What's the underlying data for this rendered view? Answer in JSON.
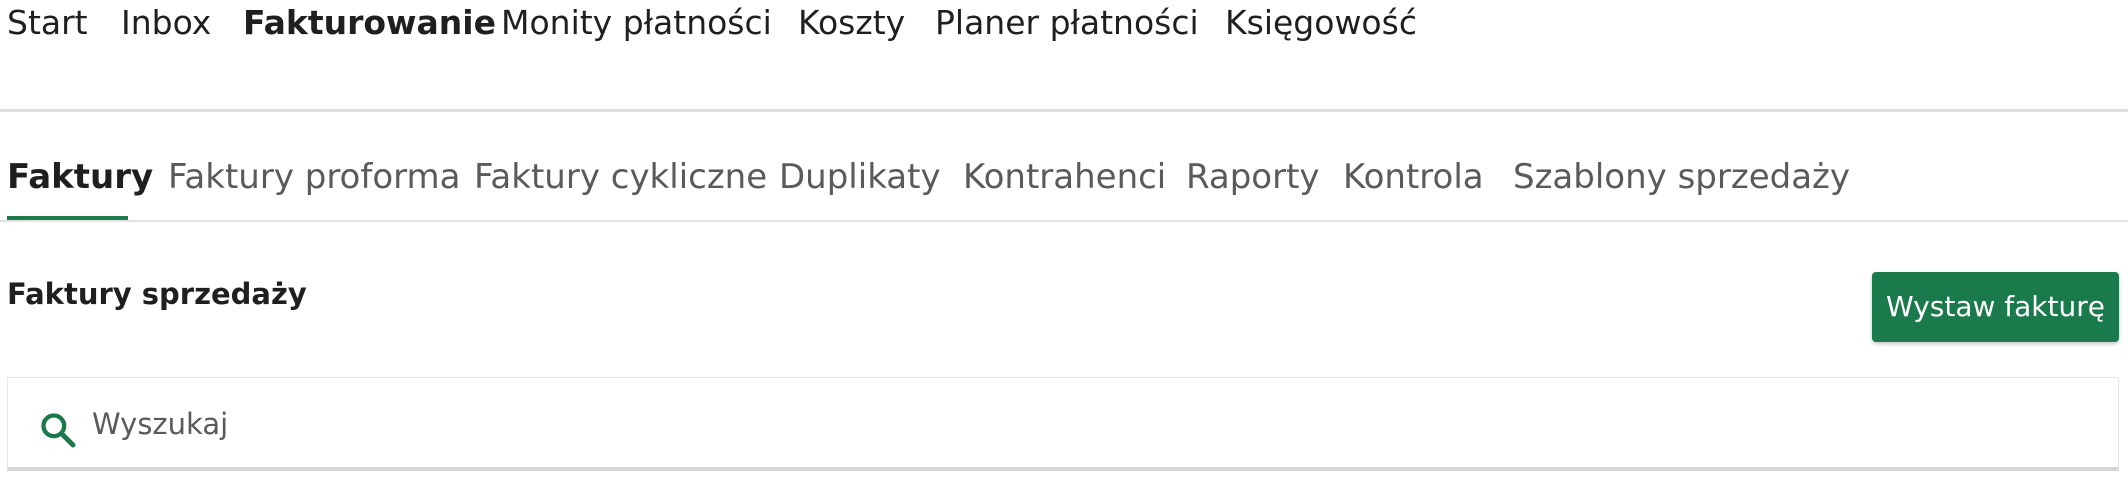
{
  "top_nav": {
    "items": [
      {
        "label": "Start"
      },
      {
        "label": "Inbox"
      },
      {
        "label": "Fakturowanie"
      },
      {
        "label": "Monity płatności"
      },
      {
        "label": "Koszty"
      },
      {
        "label": "Planer płatności"
      },
      {
        "label": "Księgowość"
      }
    ],
    "active": "Fakturowanie"
  },
  "sub_tabs": {
    "items": [
      {
        "label": "Faktury"
      },
      {
        "label": "Faktury proforma"
      },
      {
        "label": "Faktury cykliczne"
      },
      {
        "label": "Duplikaty"
      },
      {
        "label": "Kontrahenci"
      },
      {
        "label": "Raporty"
      },
      {
        "label": "Kontrola"
      },
      {
        "label": "Szablony sprzedaży"
      }
    ],
    "active": "Faktury"
  },
  "section": {
    "title": "Faktury sprzedaży",
    "primary_button_label": "Wystaw fakturę"
  },
  "search": {
    "placeholder": "Wyszukaj",
    "icon": "search-icon"
  },
  "colors": {
    "accent": "#1a7a4c",
    "text": "#1f1f1f",
    "muted_text": "#5a5a5a"
  }
}
